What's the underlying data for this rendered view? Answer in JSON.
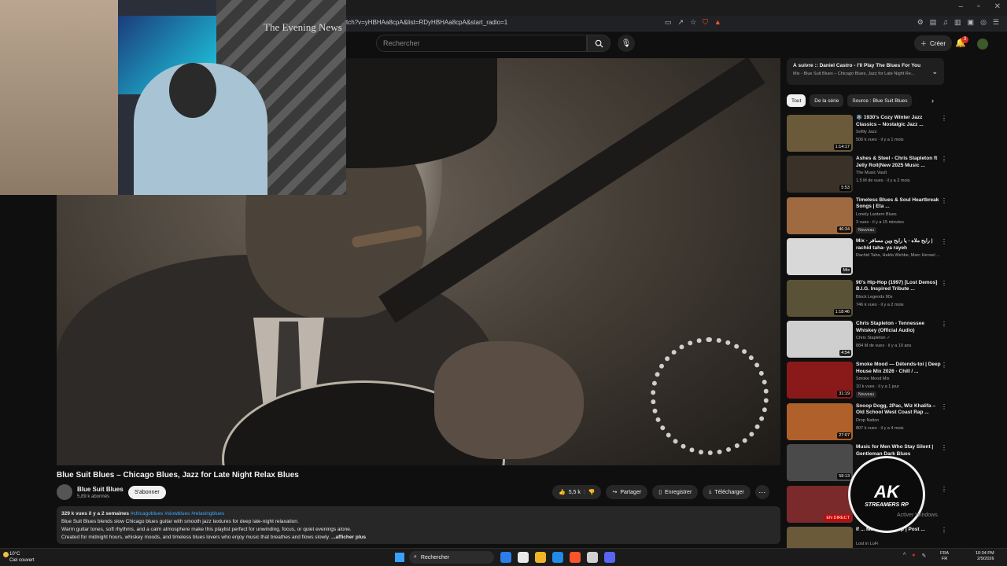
{
  "browser": {
    "url": "tch?v=yHBHAa8cpA&list=RDyHBHAa8cpA&start_radio=1",
    "minimize": "–",
    "maximize": "▫",
    "close": "✕"
  },
  "youtube_header": {
    "search_placeholder": "Rechercher",
    "create_label": "Créer",
    "notification_count": "3"
  },
  "webcam": {
    "poster_text": "The Evening News"
  },
  "video": {
    "title": "Blue Suit Blues – Chicago Blues, Jazz for Late Night Relax Blues",
    "channel_name": "Blue Suit Blues",
    "subscribers": "5,89 k abonnés",
    "subscribe_label": "S'abonner",
    "like_count": "5,5 k",
    "share_label": "Partager",
    "save_label": "Enregistrer",
    "download_label": "Télécharger",
    "description": {
      "meta": "329 k vues  il y a 2 semaines",
      "tags": "#chicagoblues #slowblues #relaxingblues",
      "line1": "Blue Suit Blues blends slow Chicago blues guitar with smooth jazz textures for deep late-night relaxation.",
      "line2": "Warm guitar tones, soft rhythms, and a calm atmosphere make this playlist perfect for unwinding, focus, or quiet evenings alone.",
      "line3": "Created for midnight hours, whiskey moods, and timeless blues lovers who enjoy music that breathes and flows slowly.",
      "more": "...afficher plus"
    }
  },
  "queue": {
    "title": "À suivre :: Daniel Castro - I'll Play The Blues For You",
    "subtitle": "Mix - Blue Suit Blues – Chicago Blues, Jazz for Late Night Re..."
  },
  "chips": [
    "Tout",
    "De la série",
    "Source : Blue Suit Blues"
  ],
  "recommendations": [
    {
      "title": "❄️ 1930's Cozy Winter Jazz Classics – Nostalgic Jazz ...",
      "channel": "Softly Jazz",
      "views": "506 k vues · il y a 1 mois",
      "duration": "1:14:17",
      "badge": "",
      "thumb_color": "#6a5a3a"
    },
    {
      "title": "Ashes & Steel - Chris Stapleton ft Jelly Roll(New 2025 Music ...",
      "channel": "The Music Vault",
      "views": "1,5 M de vues · il y a 2 mois",
      "duration": "5:53",
      "badge": "",
      "thumb_color": "#3a3228"
    },
    {
      "title": "Timeless Blues & Soul Heartbreak Songs | Eta ...",
      "channel": "Lonely Lantern Blues",
      "views": "3 vues · il y a 15 minutes",
      "duration": "46:34",
      "badge": "Nouveau",
      "thumb_color": "#a06a40"
    },
    {
      "title": "Mix - رايح ملاه - يا رايح وين مسافر | rachid taha- ya rayeh",
      "channel": "Rachid Taha, Hakfa Wehbe, Marc Hensel ...",
      "views": "",
      "duration": "Mix",
      "badge": "",
      "thumb_color": "#d8d8d8"
    },
    {
      "title": "90's Hip-Hop (1997) [Lost Demos] B.I.G. Inspired Tribute ...",
      "channel": "Block Legends 90s",
      "views": "746 k vues · il y a 2 mois",
      "duration": "1:18:46",
      "badge": "",
      "thumb_color": "#5a5236"
    },
    {
      "title": "Chris Stapleton - Tennessee Whiskey (Official Audio)",
      "channel": "Chris Stapleton ✓",
      "views": "884 M de vues · il y a 10 ans",
      "duration": "4:54",
      "badge": "",
      "thumb_color": "#cfcfcf"
    },
    {
      "title": "Smoke Mood — Détends-toi | Deep House Mix 2026 · Chill / ...",
      "channel": "Smoke Mood Mix",
      "views": "10 k vues · il y a 1 jour",
      "duration": "31:19",
      "badge": "Nouveau",
      "thumb_color": "#8a1a1a"
    },
    {
      "title": "Snoop Dogg, 2Pac, Wiz Khalifa – Old School West Coast Rap ...",
      "channel": "Drop Nation",
      "views": "807 k vues · il y a 4 mois",
      "duration": "27:07",
      "badge": "",
      "thumb_color": "#b0602a"
    },
    {
      "title": "Music for Men Who Stay Silent | Gentleman Dark Blues",
      "channel": "",
      "views": "",
      "duration": "58:13",
      "badge": "",
      "thumb_color": "#4a4a4a"
    },
    {
      "title": "",
      "channel": "",
      "views": "",
      "duration": "EN DIRECT",
      "badge": "",
      "thumb_color": "#7a2a2a"
    },
    {
      "title": "If ... Made Lo ... Hop | Post ...",
      "channel": "Lost in LoFi",
      "views": "",
      "duration": "",
      "badge": "",
      "thumb_color": "#6a5a3a"
    }
  ],
  "logo": {
    "main": "AK",
    "sub": "STREAMERS RP"
  },
  "windows_watermark": "Activer Windows",
  "taskbar": {
    "temperature": "10°C",
    "weather": "Ciel couvert",
    "search_label": "Rechercher",
    "lang1": "FRA",
    "lang2": "FR",
    "time": "10:34 PM",
    "date": "2/9/2026"
  }
}
